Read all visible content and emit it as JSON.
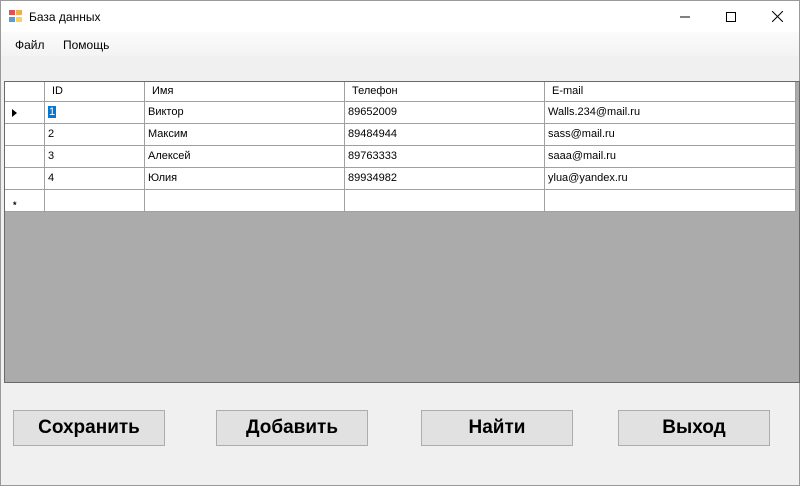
{
  "window": {
    "title": "База данных"
  },
  "menu": {
    "items": [
      {
        "label": "Файл"
      },
      {
        "label": "Помощь"
      }
    ]
  },
  "table": {
    "columns": [
      "ID",
      "Имя",
      "Телефон",
      "E-mail"
    ],
    "rows": [
      {
        "id": "1",
        "name": "Виктор",
        "phone": "89652009",
        "email": "Walls.234@mail.ru"
      },
      {
        "id": "2",
        "name": "Максим",
        "phone": "89484944",
        "email": "sass@mail.ru"
      },
      {
        "id": "3",
        "name": "Алексей",
        "phone": "89763333",
        "email": "saaa@mail.ru"
      },
      {
        "id": "4",
        "name": "Юлия",
        "phone": "89934982",
        "email": "ylua@yandex.ru"
      }
    ],
    "new_row_marker": "*"
  },
  "buttons": {
    "save": "Сохранить",
    "add": "Добавить",
    "find": "Найти",
    "exit": "Выход"
  },
  "colors": {
    "grid_background": "#ababab",
    "selection": "#0078d7",
    "button_face": "#e1e1e1"
  }
}
